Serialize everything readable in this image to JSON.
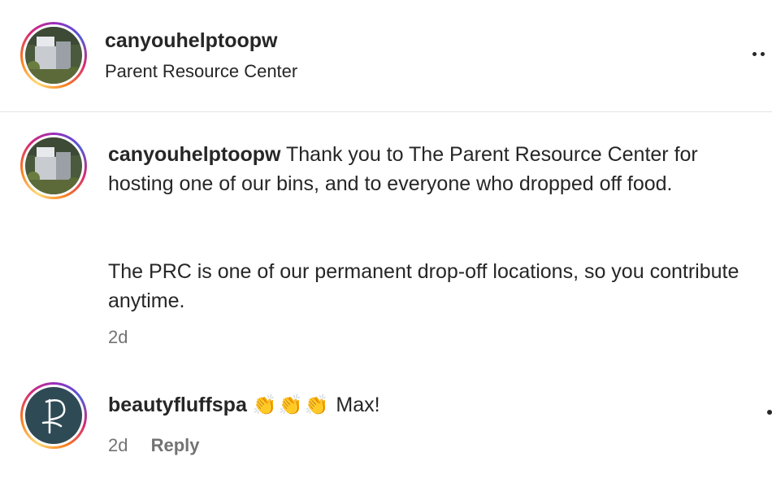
{
  "header": {
    "username": "canyouhelptoopw",
    "subtitle": "Parent Resource Center"
  },
  "comments": [
    {
      "username": "canyouhelptoopw",
      "text_para1": "Thank you to The Parent Resource Center for hosting one of our bins, and to everyone who dropped off food.",
      "text_para2": "The PRC is one of our permanent drop-off locations, so you contribute anytime.",
      "time": "2d"
    },
    {
      "username": "beautyfluffspa",
      "emojis": "👏👏👏",
      "text": "Max!",
      "time": "2d",
      "reply_label": "Reply"
    }
  ],
  "icons": {
    "more": "more-options-icon"
  }
}
